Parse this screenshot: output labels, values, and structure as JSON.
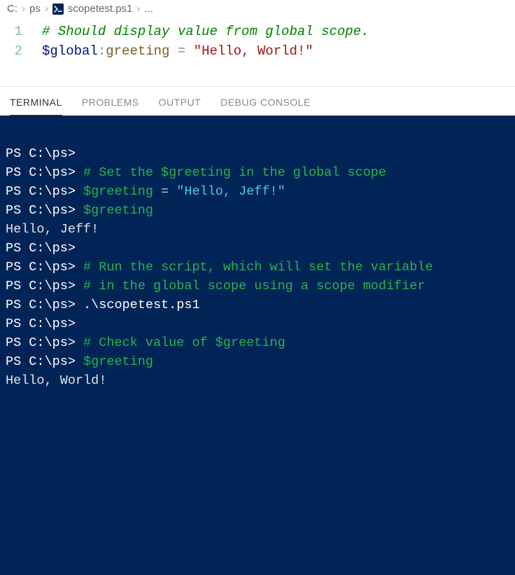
{
  "breadcrumb": {
    "segs": [
      "C:",
      "ps",
      "scopetest.ps1",
      "..."
    ],
    "chev": "›"
  },
  "editor": {
    "lines": [
      {
        "num": "1",
        "tokens": [
          {
            "cls": "tok-comment",
            "text": "# Should display value from global scope."
          }
        ]
      },
      {
        "num": "2",
        "tokens": [
          {
            "cls": "tok-var",
            "text": "$global"
          },
          {
            "cls": "tok-op",
            "text": ":"
          },
          {
            "cls": "tok-member",
            "text": "greeting"
          },
          {
            "cls": "",
            "text": " "
          },
          {
            "cls": "tok-op",
            "text": "="
          },
          {
            "cls": "",
            "text": " "
          },
          {
            "cls": "tok-string",
            "text": "\"Hello, World!\""
          }
        ]
      }
    ]
  },
  "panel": {
    "tabs": [
      "TERMINAL",
      "PROBLEMS",
      "OUTPUT",
      "DEBUG CONSOLE"
    ],
    "active": 0
  },
  "terminal": {
    "prompt": "PS C:\\ps>",
    "lines": [
      {
        "kind": "blank"
      },
      {
        "kind": "prompt_only"
      },
      {
        "kind": "comment",
        "text": "# Set the $greeting in the global scope"
      },
      {
        "kind": "assign",
        "var": "$greeting",
        "op": "=",
        "str": "\"Hello, Jeff!\""
      },
      {
        "kind": "varcmd",
        "var": "$greeting"
      },
      {
        "kind": "output",
        "text": "Hello, Jeff!"
      },
      {
        "kind": "prompt_only"
      },
      {
        "kind": "comment",
        "text": "# Run the script, which will set the variable"
      },
      {
        "kind": "comment",
        "text": "# in the global scope using a scope modifier"
      },
      {
        "kind": "cmd",
        "text": ".\\scopetest.ps1"
      },
      {
        "kind": "prompt_only"
      },
      {
        "kind": "comment",
        "text": "# Check value of $greeting"
      },
      {
        "kind": "varcmd",
        "var": "$greeting"
      },
      {
        "kind": "output",
        "text": "Hello, World!"
      }
    ]
  }
}
